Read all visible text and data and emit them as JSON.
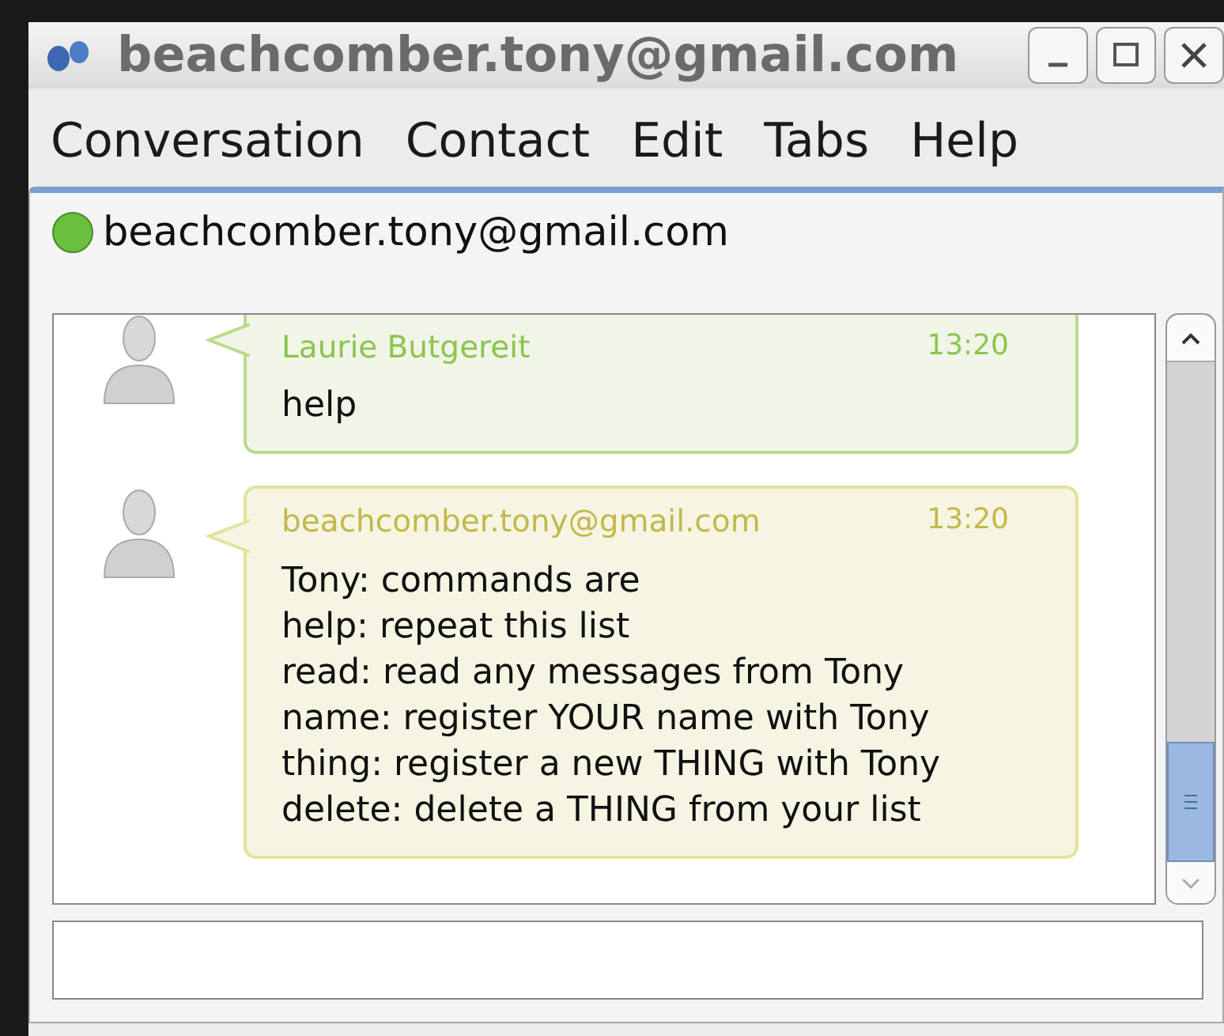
{
  "window": {
    "title": "beachcomber.tony@gmail.com"
  },
  "menu": [
    "Conversation",
    "Contact",
    "Edit",
    "Tabs",
    "Help"
  ],
  "contact": {
    "name": "beachcomber.tony@gmail.com",
    "online": true
  },
  "messages": [
    {
      "kind": "incoming",
      "sender": "Laurie Butgereit",
      "time": "13:20",
      "lines": [
        "help"
      ]
    },
    {
      "kind": "outgoing",
      "sender": "beachcomber.tony@gmail.com",
      "time": "13:20",
      "lines": [
        "Tony: commands are",
        "help: repeat this list",
        "read: read any messages from Tony",
        "name: register YOUR name with Tony",
        "thing: register a new THING with Tony",
        "delete: delete a THING from your list"
      ]
    }
  ]
}
